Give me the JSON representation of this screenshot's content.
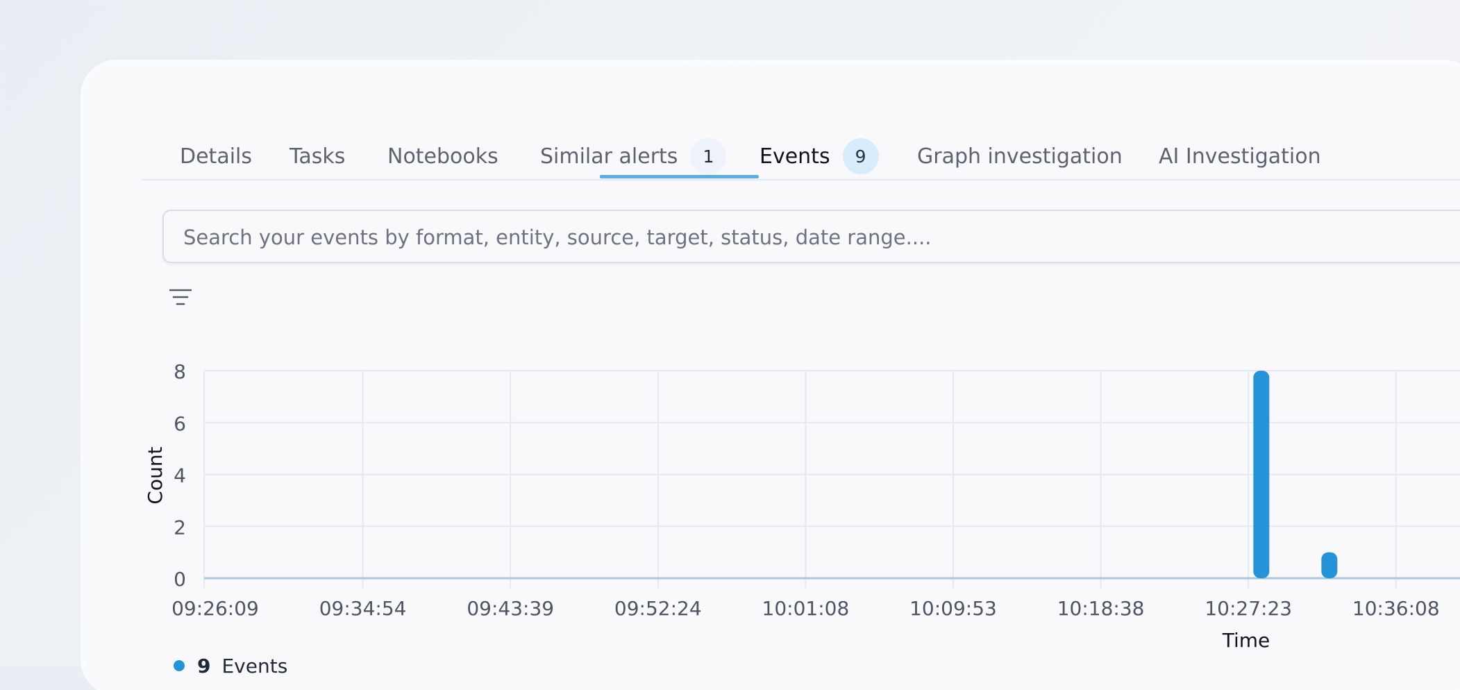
{
  "tabs": [
    {
      "label": "Details"
    },
    {
      "label": "Tasks"
    },
    {
      "label": "Notebooks"
    },
    {
      "label": "Similar alerts",
      "badge": "1"
    },
    {
      "label": "Events",
      "badge": "9",
      "active": true
    },
    {
      "label": "Graph investigation"
    },
    {
      "label": "AI Investigation"
    }
  ],
  "search": {
    "placeholder": "Search your events by format, entity, source, target, status, date range...."
  },
  "icons": {
    "filter": "filter-lines-icon"
  },
  "colors": {
    "accent": "#5aaee6",
    "bar": "#2493d8",
    "grid": "#e3e8f3"
  },
  "chart_data": {
    "type": "bar",
    "xlabel": "Time",
    "ylabel": "Count",
    "ylim": [
      0,
      8
    ],
    "yticks": [
      0,
      2,
      4,
      6,
      8
    ],
    "xticks": [
      "09:26:09",
      "09:34:54",
      "09:43:39",
      "09:52:24",
      "10:01:08",
      "10:09:53",
      "10:18:38",
      "10:27:23",
      "10:36:08"
    ],
    "series": [
      {
        "name": "Events",
        "points": [
          {
            "x": "10:28:10",
            "y": 8
          },
          {
            "x": "10:32:12",
            "y": 1
          }
        ]
      }
    ],
    "legend": {
      "count": "9",
      "label": "Events"
    },
    "grid": true
  }
}
